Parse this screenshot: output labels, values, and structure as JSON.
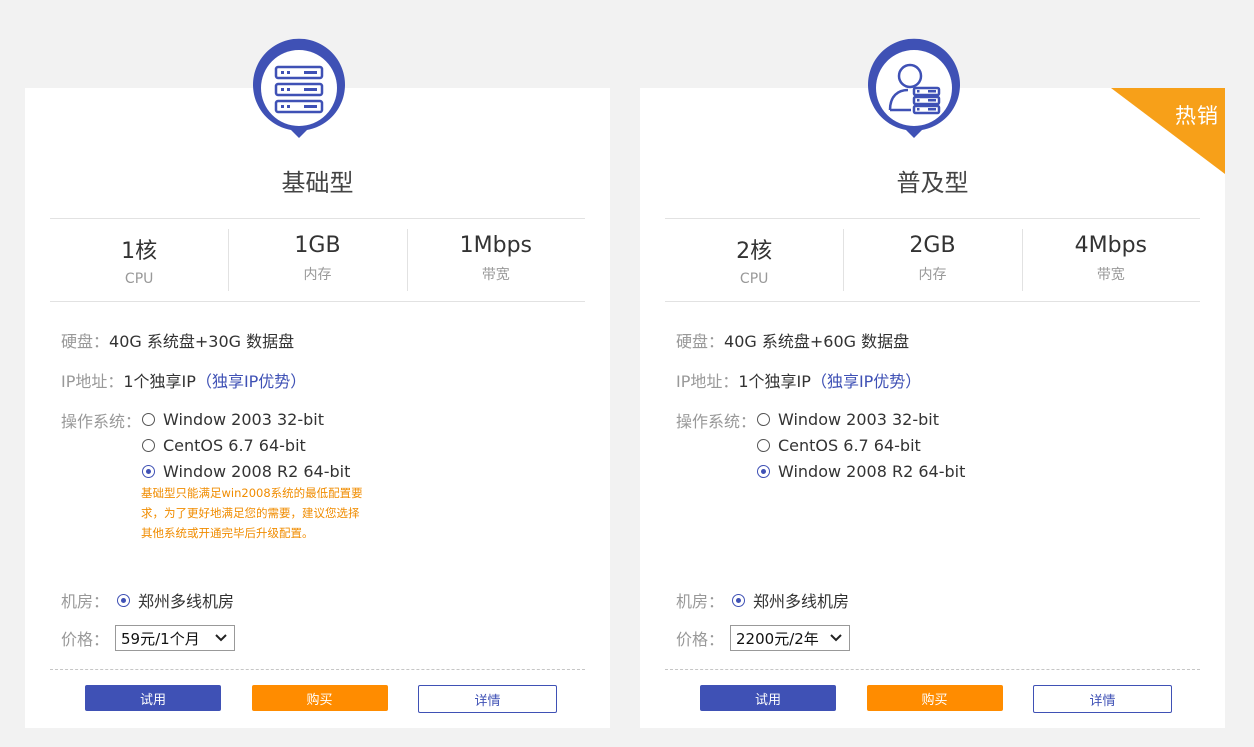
{
  "colors": {
    "primary": "#3f51b5",
    "orange": "#ff8c00",
    "ribbon": "#f7a019",
    "note": "#f08c00"
  },
  "labels": {
    "disk": "硬盘：",
    "ip": "IP地址：",
    "os": "操作系统：",
    "datacenter": "机房：",
    "price": "价格："
  },
  "plans": [
    {
      "icon": "server-rack-icon",
      "title": "基础型",
      "specs": [
        {
          "value": "1核",
          "label": "CPU"
        },
        {
          "value": "1GB",
          "label": "内存"
        },
        {
          "value": "1Mbps",
          "label": "带宽"
        }
      ],
      "disk": "40G 系统盘+30G 数据盘",
      "ip": "1个独享IP",
      "ip_link": "（独享IP优势）",
      "os_options": [
        {
          "label": "Window 2003 32-bit",
          "selected": false
        },
        {
          "label": "CentOS 6.7 64-bit",
          "selected": false
        },
        {
          "label": "Window 2008 R2 64-bit",
          "selected": true
        }
      ],
      "note": "基础型只能满足win2008系统的最低配置要求，为了更好地满足您的需要，建议您选择其他系统或开通完毕后升级配置。",
      "datacenter": "郑州多线机房",
      "price": "59元/1个月",
      "buttons": {
        "try": "试用",
        "buy": "购买",
        "info": "详情"
      }
    },
    {
      "icon": "user-server-icon",
      "title": "普及型",
      "ribbon": "热销",
      "specs": [
        {
          "value": "2核",
          "label": "CPU"
        },
        {
          "value": "2GB",
          "label": "内存"
        },
        {
          "value": "4Mbps",
          "label": "带宽"
        }
      ],
      "disk": "40G 系统盘+60G 数据盘",
      "ip": "1个独享IP",
      "ip_link": "（独享IP优势）",
      "os_options": [
        {
          "label": "Window 2003 32-bit",
          "selected": false
        },
        {
          "label": "CentOS 6.7 64-bit",
          "selected": false
        },
        {
          "label": "Window 2008 R2 64-bit",
          "selected": true
        }
      ],
      "datacenter": "郑州多线机房",
      "price": "2200元/2年",
      "buttons": {
        "try": "试用",
        "buy": "购买",
        "info": "详情"
      }
    }
  ]
}
